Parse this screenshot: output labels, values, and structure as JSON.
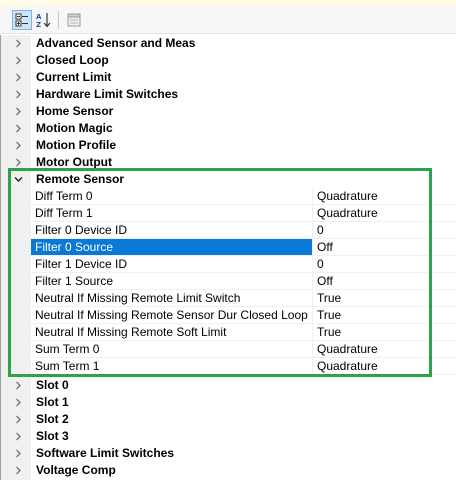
{
  "toolbar": {
    "buttons": [
      {
        "icon": "categorized-icon",
        "active": true
      },
      {
        "icon": "sort-alphabetical-icon",
        "active": false
      },
      {
        "icon": "property-pages-icon",
        "active": false
      }
    ]
  },
  "categories_before": [
    "Advanced Sensor and Meas",
    "Closed Loop",
    "Current Limit",
    "Hardware Limit Switches",
    "Home Sensor",
    "Motion Magic",
    "Motion Profile",
    "Motor Output"
  ],
  "expanded_category": {
    "label": "Remote Sensor",
    "properties": [
      {
        "name": "Diff Term 0",
        "value": "Quadrature"
      },
      {
        "name": "Diff Term 1",
        "value": "Quadrature"
      },
      {
        "name": "Filter 0 Device ID",
        "value": "0"
      },
      {
        "name": "Filter 0 Source",
        "value": "Off",
        "selected": true
      },
      {
        "name": "Filter 1 Device ID",
        "value": "0"
      },
      {
        "name": "Filter 1 Source",
        "value": "Off"
      },
      {
        "name": "Neutral If Missing Remote Limit Switch",
        "value": "True"
      },
      {
        "name": "Neutral If Missing Remote Sensor Dur Closed Loop",
        "value": "True"
      },
      {
        "name": "Neutral If Missing Remote Soft Limit",
        "value": "True"
      },
      {
        "name": "Sum Term 0",
        "value": "Quadrature"
      },
      {
        "name": "Sum Term 1",
        "value": "Quadrature"
      }
    ]
  },
  "categories_after": [
    "Slot 0",
    "Slot 1",
    "Slot 2",
    "Slot 3",
    "Software Limit Switches",
    "Voltage Comp"
  ],
  "colors": {
    "selection": "#0a78d7",
    "highlight_border": "#2aa34a",
    "gutter": "#f0f0f0"
  }
}
